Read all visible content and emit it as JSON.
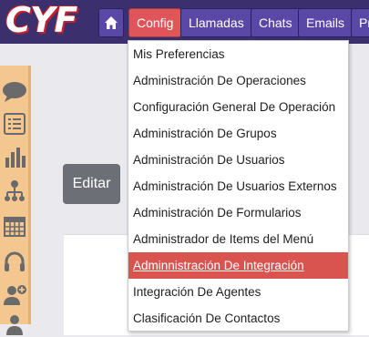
{
  "brand": {
    "logo_text": "CYF"
  },
  "nav": {
    "home_icon": "home-icon",
    "tabs": [
      {
        "label": "Config",
        "active": true
      },
      {
        "label": "Llamadas",
        "active": false
      },
      {
        "label": "Chats",
        "active": false
      },
      {
        "label": "Emails",
        "active": false
      },
      {
        "label": "Pr",
        "active": false
      }
    ]
  },
  "sidebar": {
    "icons": [
      "chat-bubble-icon",
      "list-icon",
      "bar-chart-icon",
      "org-chart-icon",
      "calendar-icon",
      "headset-icon",
      "user-add-icon",
      "user-icon"
    ]
  },
  "main": {
    "edit_button": "Editar"
  },
  "config_menu": {
    "items": [
      "Mis Preferencias",
      "Administración De Operaciones",
      "Configuración General De Operación",
      "Administración De Grupos",
      "Administración De Usuarios",
      "Administración De Usuarios Externos",
      "Administración De Formularios",
      "Administrador de Items del Menú",
      "Adminnistración De Integración",
      "Integración De Agentes",
      "Clasificación De Contactos"
    ],
    "highlighted_index": 8
  },
  "colors": {
    "topbar": "#3b2f6e",
    "nav_button": "#5a48a6",
    "active_tab": "#e0555a",
    "highlight": "#d9534f",
    "sidebar": "#f4c790",
    "sidebar_icon": "#6a6a6a"
  }
}
